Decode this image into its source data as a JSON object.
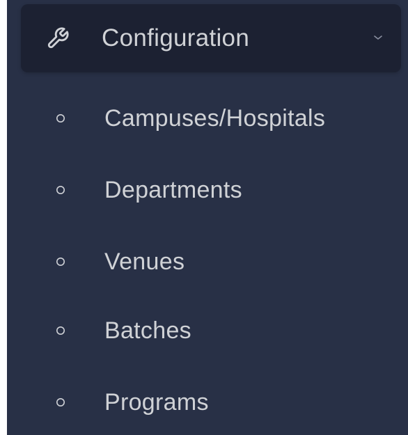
{
  "sidebar": {
    "group": {
      "label": "Configuration",
      "icon": "wrench-icon",
      "expanded": true,
      "chevron": "chevron-down-icon"
    },
    "items": [
      {
        "label": "Campuses/Hospitals",
        "icon": "circle-icon"
      },
      {
        "label": "Departments",
        "icon": "circle-icon"
      },
      {
        "label": "Venues",
        "icon": "circle-icon"
      },
      {
        "label": "Batches",
        "icon": "circle-icon"
      },
      {
        "label": "Programs",
        "icon": "circle-icon"
      }
    ]
  },
  "colors": {
    "sidebar_background": "#283046",
    "group_header_background": "#1c2132",
    "text": "#d0d2d6",
    "icon": "#cfd1d6"
  }
}
